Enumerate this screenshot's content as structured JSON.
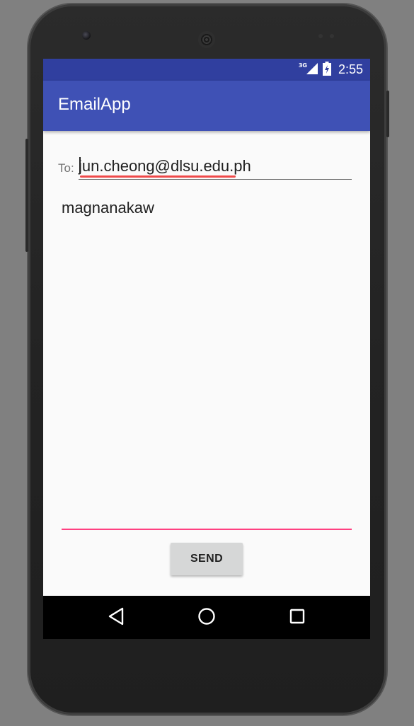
{
  "status_bar": {
    "network_type": "3G",
    "time": "2:55"
  },
  "app_bar": {
    "title": "EmailApp"
  },
  "compose": {
    "to_label": "To:",
    "to_value": "jun.cheong@dlsu.edu.ph",
    "body_value": "magnanakaw",
    "send_label": "SEND"
  },
  "colors": {
    "status_bar": "#303f9f",
    "app_bar": "#3f51b5",
    "accent": "#ff4081",
    "spellcheck_underline": "#ef4a4a"
  },
  "icons": {
    "signal": "cell-signal-icon",
    "battery": "battery-charging-icon",
    "back": "back-triangle-icon",
    "home": "home-circle-icon",
    "recents": "recents-square-icon"
  }
}
